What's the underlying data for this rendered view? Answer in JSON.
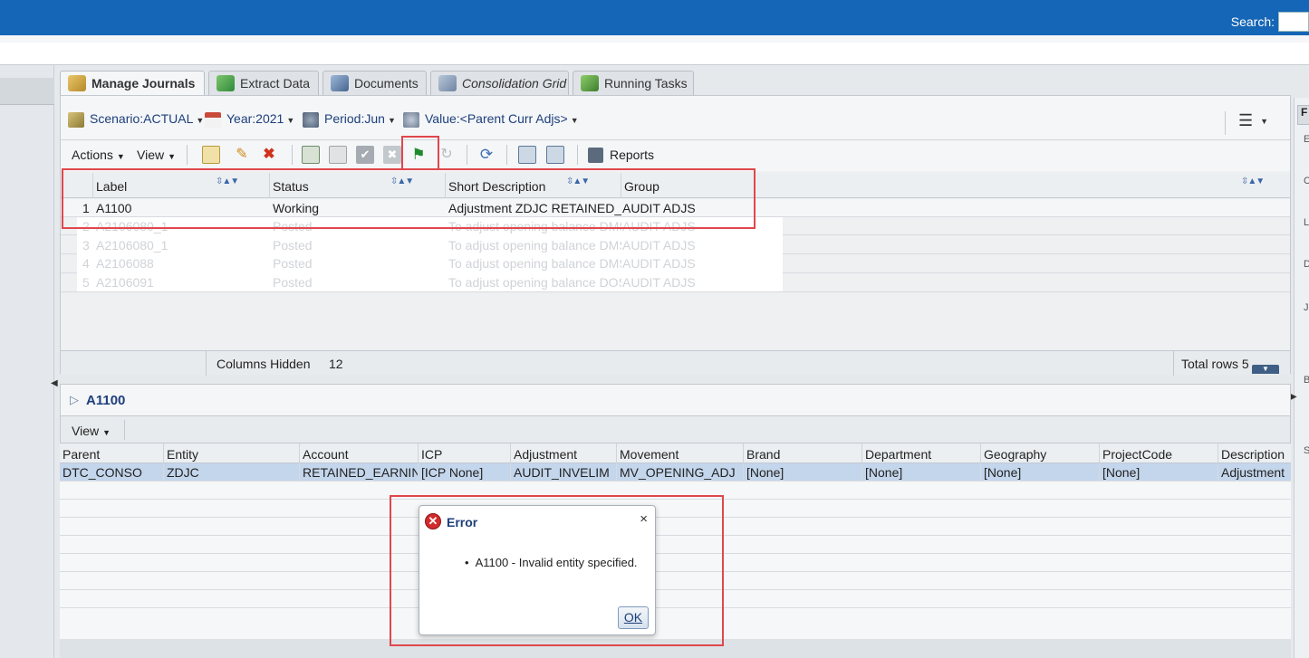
{
  "header": {
    "search_label": "Search:"
  },
  "tabs": [
    {
      "label": "Manage Journals",
      "icon": "journal-icon",
      "active": true
    },
    {
      "label": "Extract Data",
      "icon": "extract-icon"
    },
    {
      "label": "Documents",
      "icon": "documents-icon"
    },
    {
      "label": "Consolidation Grid",
      "icon": "grid-icon"
    },
    {
      "label": "Running Tasks",
      "icon": "tasks-icon"
    }
  ],
  "pov": {
    "scenario": "Scenario:ACTUAL",
    "year": "Year:2021",
    "period": "Period:Jun",
    "value": "Value:<Parent Curr Adjs>"
  },
  "toolbar": {
    "actions_label": "Actions",
    "view_label": "View",
    "reports_label": "Reports"
  },
  "journals": {
    "columns": [
      "Label",
      "Status",
      "Short Description",
      "Group"
    ],
    "rows": [
      {
        "n": "1",
        "label": "A1100",
        "status": "Working",
        "desc": "Adjustment ZDJC RETAINED_E",
        "group": "AUDIT ADJS"
      },
      {
        "n": "2",
        "label": "A2106080_1",
        "status": "Posted",
        "desc": "To adjust opening balance DMS",
        "group": "AUDIT ADJS"
      },
      {
        "n": "3",
        "label": "A2106080_1",
        "status": "Posted",
        "desc": "To adjust opening balance DMS",
        "group": "AUDIT ADJS"
      },
      {
        "n": "4",
        "label": "A2106088",
        "status": "Posted",
        "desc": "To adjust opening balance DMS",
        "group": "AUDIT ADJS"
      },
      {
        "n": "5",
        "label": "A2106091",
        "status": "Posted",
        "desc": "To adjust opening balance DOS",
        "group": "AUDIT ADJS"
      }
    ],
    "columns_hidden_label": "Columns Hidden",
    "columns_hidden_value": "12",
    "total_rows": "Total rows 5"
  },
  "detail": {
    "title": "A1100",
    "view_label": "View",
    "columns": [
      "Parent",
      "Entity",
      "Account",
      "ICP",
      "Adjustment",
      "Movement",
      "Brand",
      "Department",
      "Geography",
      "ProjectCode",
      "Description"
    ],
    "row": [
      "DTC_CONSO",
      "ZDJC",
      "RETAINED_EARNINGS",
      "[ICP None]",
      "AUDIT_INVELIM",
      "MV_OPENING_ADJ",
      "[None]",
      "[None]",
      "[None]",
      "[None]",
      "Adjustment"
    ]
  },
  "dialog": {
    "title": "Error",
    "message": "A1100 - Invalid entity specified.",
    "ok_label": "OK",
    "close_glyph": "×"
  },
  "right_rail": {
    "tab_label": "F",
    "letters": [
      "E",
      "C",
      "L",
      "D",
      "Jc",
      "B",
      "S"
    ]
  },
  "colors": {
    "header": "#1566b6",
    "highlight": "#e0474c",
    "selected_row": "#c4d6ec",
    "error": "#d22b2b"
  }
}
